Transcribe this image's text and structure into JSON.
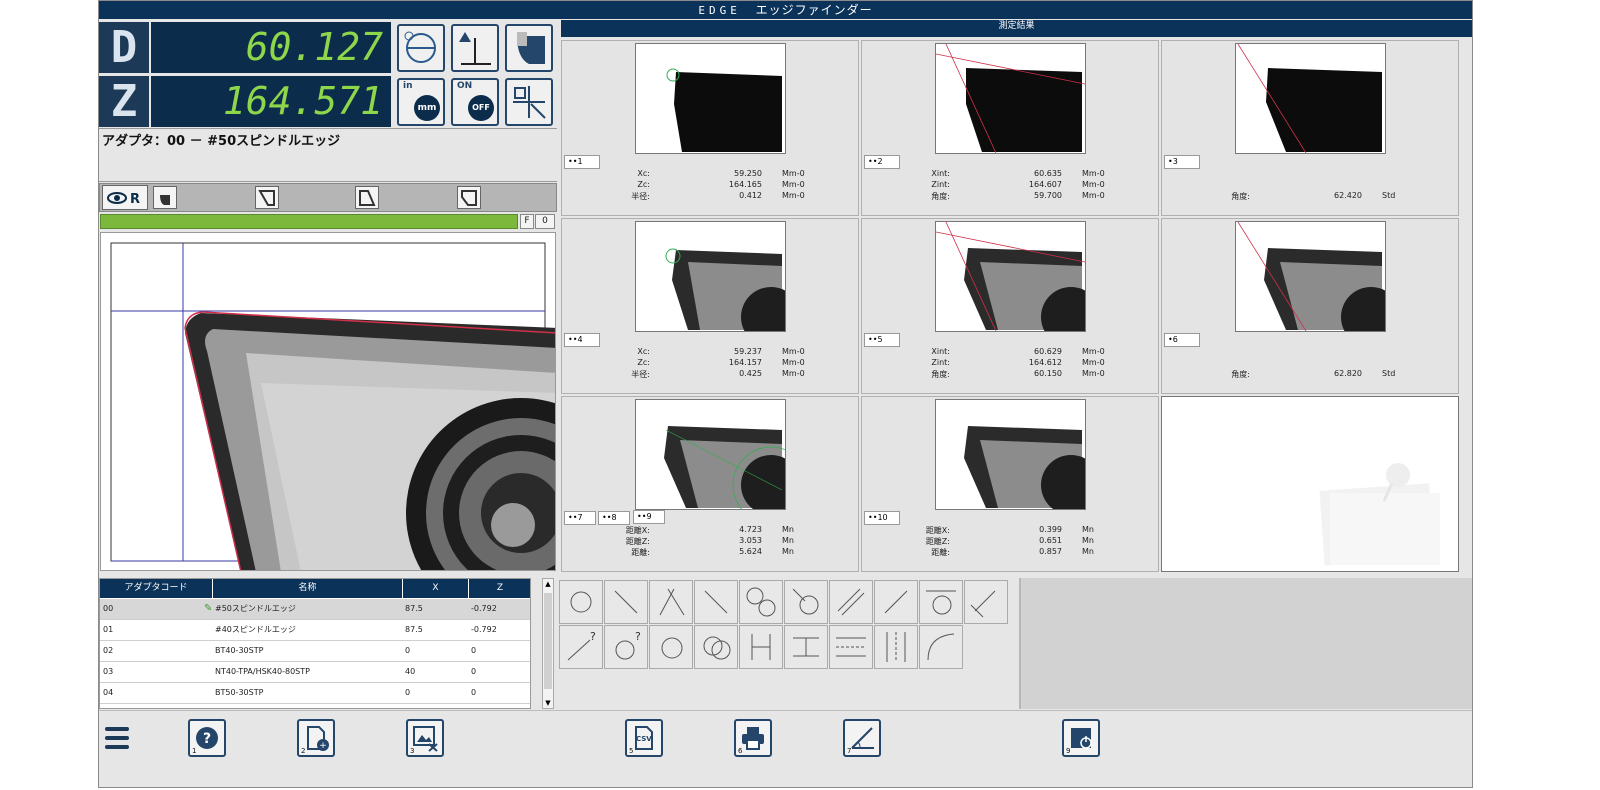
{
  "title": {
    "logo": "EDGE",
    "app_name": "エッジファインダー"
  },
  "dro": {
    "axis_d": "D",
    "value_d": "60.127",
    "axis_z": "Z",
    "value_z": "164.571",
    "unit_in": "in",
    "unit_mm": "mm",
    "on_label": "ON",
    "off_label": "OFF"
  },
  "adapter_label": "アダプタ：00 － #50スピンドルエッジ",
  "progress": {
    "fill": 1.0,
    "f_label": "F",
    "count": "0"
  },
  "results": {
    "header": "測定結果",
    "cells": [
      {
        "tag": "••1",
        "rows": [
          [
            "Xc:",
            "59.250",
            "Mm-0"
          ],
          [
            "Zc:",
            "164.165",
            "Mm-0"
          ],
          [
            "半径:",
            "0.412",
            "Mm-0"
          ]
        ]
      },
      {
        "tag": "••2",
        "rows": [
          [
            "Xint:",
            "60.635",
            "Mm-0"
          ],
          [
            "Zint:",
            "164.607",
            "Mm-0"
          ],
          [
            "角度:",
            "59.700",
            "Mm-0"
          ]
        ]
      },
      {
        "tag": "•3",
        "rows": [
          [
            "角度:",
            "62.420",
            "Std"
          ]
        ]
      },
      {
        "tag": "••4",
        "rows": [
          [
            "Xc:",
            "59.237",
            "Mm-0"
          ],
          [
            "Zc:",
            "164.157",
            "Mm-0"
          ],
          [
            "半径:",
            "0.425",
            "Mm-0"
          ]
        ]
      },
      {
        "tag": "••5",
        "rows": [
          [
            "Xint:",
            "60.629",
            "Mm-0"
          ],
          [
            "Zint:",
            "164.612",
            "Mm-0"
          ],
          [
            "角度:",
            "60.150",
            "Mm-0"
          ]
        ]
      },
      {
        "tag": "•6",
        "rows": [
          [
            "角度:",
            "62.820",
            "Std"
          ]
        ]
      },
      {
        "tag": "••7",
        "tag2": "••8",
        "tag3": "••9",
        "rows": [
          [
            "距離X:",
            "4.723",
            "Mn"
          ],
          [
            "距離Z:",
            "3.053",
            "Mn"
          ],
          [
            "距離:",
            "5.624",
            "Mn"
          ]
        ]
      },
      {
        "tag": "••10",
        "rows": [
          [
            "距離X:",
            "0.399",
            "Mn"
          ],
          [
            "距離Z:",
            "0.651",
            "Mn"
          ],
          [
            "距離:",
            "0.857",
            "Mn"
          ]
        ]
      }
    ]
  },
  "table": {
    "headers": [
      "アダプタコード",
      "名称",
      "X",
      "Z"
    ],
    "rows": [
      {
        "code": "00",
        "name": "#50スピンドルエッジ",
        "x": "87.5",
        "z": "-0.792"
      },
      {
        "code": "01",
        "name": "#40スピンドルエッジ",
        "x": "87.5",
        "z": "-0.792"
      },
      {
        "code": "02",
        "name": "BT40-30STP",
        "x": "0",
        "z": "0"
      },
      {
        "code": "03",
        "name": "NT40-TPA/HSK40-80STP",
        "x": "40",
        "z": "0"
      },
      {
        "code": "04",
        "name": "BT50-30STP",
        "x": "0",
        "z": "0"
      }
    ]
  },
  "footer": {
    "buttons": [
      {
        "num": "1",
        "icon": "help-icon"
      },
      {
        "num": "2",
        "icon": "new-file-icon"
      },
      {
        "num": "3",
        "icon": "clear-image-icon"
      },
      {
        "num": "5",
        "icon": "csv-icon",
        "text": "CSV"
      },
      {
        "num": "6",
        "icon": "print-icon"
      },
      {
        "num": "7",
        "icon": "angle-icon"
      },
      {
        "num": "9",
        "icon": "power-icon"
      }
    ]
  },
  "colors": {
    "navy": "#0b3259",
    "dro_green": "#8ed64a",
    "progress_green": "#7cb83b"
  }
}
